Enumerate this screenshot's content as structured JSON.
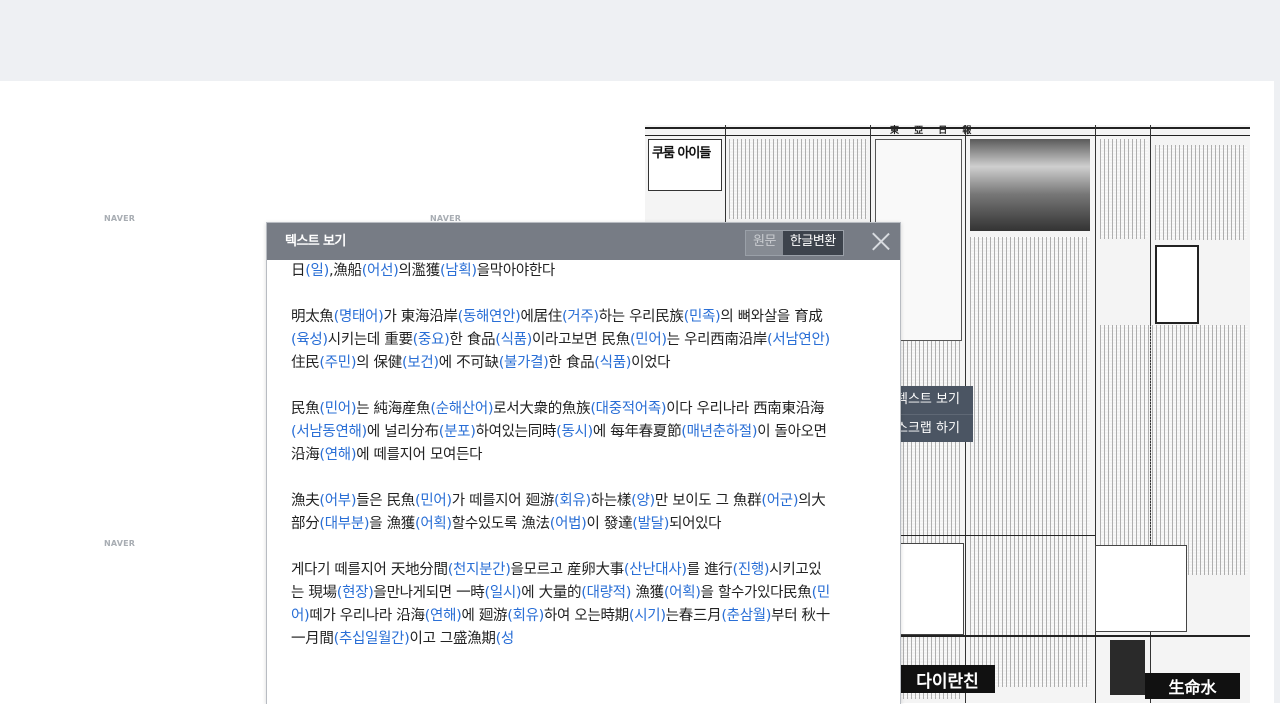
{
  "page": {
    "watermark": "NAVER"
  },
  "panel": {
    "title": "텍스트 보기",
    "toggle_original": "원문",
    "toggle_korean": "한글변환",
    "paragraphs": [
      [
        {
          "t": "日"
        },
        {
          "h": "(일)"
        },
        {
          "t": ","
        },
        {
          "t": "漁船"
        },
        {
          "h": "(어선)"
        },
        {
          "t": "의濫獲"
        },
        {
          "h": "(남획)"
        },
        {
          "t": "을막아야한다"
        }
      ],
      [
        {
          "t": " 明太魚"
        },
        {
          "h": "(명태어)"
        },
        {
          "t": "가 東海沿岸"
        },
        {
          "h": "(동해연안)"
        },
        {
          "t": "에居住"
        },
        {
          "h": "(거주)"
        },
        {
          "t": "하는 우리民族"
        },
        {
          "h": "(민족)"
        },
        {
          "t": "의 뼈와살을 育成"
        },
        {
          "h": "(육성)"
        },
        {
          "t": "시키는데 重要"
        },
        {
          "h": "(중요)"
        },
        {
          "t": "한 食品"
        },
        {
          "h": "(식품)"
        },
        {
          "t": "이라고보면 民魚"
        },
        {
          "h": "(민어)"
        },
        {
          "t": "는 우리西南沿岸"
        },
        {
          "h": "(서남연안)"
        },
        {
          "t": " 住民"
        },
        {
          "h": "(주민)"
        },
        {
          "t": "의 保健"
        },
        {
          "h": "(보건)"
        },
        {
          "t": "에 不可缺"
        },
        {
          "h": "(불가결)"
        },
        {
          "t": "한 食品"
        },
        {
          "h": "(식품)"
        },
        {
          "t": "이었다"
        }
      ],
      [
        {
          "t": " 民魚"
        },
        {
          "h": "(민어)"
        },
        {
          "t": "는 純海産魚"
        },
        {
          "h": "(순해산어)"
        },
        {
          "t": "로서大衆的魚族"
        },
        {
          "h": "(대중적어족)"
        },
        {
          "t": "이다 우리나라 西南東沿海"
        },
        {
          "h": "(서남동연해)"
        },
        {
          "t": "에 널리分布"
        },
        {
          "h": "(분포)"
        },
        {
          "t": "하여있는同時"
        },
        {
          "h": "(동시)"
        },
        {
          "t": "에 每年春夏節"
        },
        {
          "h": "(매년춘하절)"
        },
        {
          "t": "이 돌아오면 沿海"
        },
        {
          "h": "(연해)"
        },
        {
          "t": "에 떼를지어 모여든다"
        }
      ],
      [
        {
          "t": " 漁夫"
        },
        {
          "h": "(어부)"
        },
        {
          "t": "들은 民魚"
        },
        {
          "h": "(민어)"
        },
        {
          "t": "가 떼를지어 廻游"
        },
        {
          "h": "(회유)"
        },
        {
          "t": "하는樣"
        },
        {
          "h": "(양)"
        },
        {
          "t": "만 보이도 그 魚群"
        },
        {
          "h": "(어군)"
        },
        {
          "t": "의大部分"
        },
        {
          "h": "(대부분)"
        },
        {
          "t": "을 漁獲"
        },
        {
          "h": "(어획)"
        },
        {
          "t": "할수있도록 漁法"
        },
        {
          "h": "(어법)"
        },
        {
          "t": "이 發達"
        },
        {
          "h": "(발달)"
        },
        {
          "t": "되어있다"
        }
      ],
      [
        {
          "t": " 게다기 떼를지어 天地分間"
        },
        {
          "h": "(천지분간)"
        },
        {
          "t": "을모르고 産卵大事"
        },
        {
          "h": "(산난대사)"
        },
        {
          "t": "를 進行"
        },
        {
          "h": "(진행)"
        },
        {
          "t": "시키고있는 現場"
        },
        {
          "h": "(현장)"
        },
        {
          "t": "을만나게되면 一時"
        },
        {
          "h": "(일시)"
        },
        {
          "t": "에 大量的"
        },
        {
          "h": "(대량적)"
        },
        {
          "t": " 漁獲"
        },
        {
          "h": "(어획)"
        },
        {
          "t": "을 할수가있다民魚"
        },
        {
          "h": "(민어)"
        },
        {
          "t": "떼가 우리나라 沿海"
        },
        {
          "h": "(연해)"
        },
        {
          "t": "에 廻游"
        },
        {
          "h": "(회유)"
        },
        {
          "t": "하여 오는時期"
        },
        {
          "h": "(시기)"
        },
        {
          "t": "는春三月"
        },
        {
          "h": "(춘삼월)"
        },
        {
          "t": "부터 秋十一月間"
        },
        {
          "h": "(추십일월간)"
        },
        {
          "t": "이고 그盛漁期"
        },
        {
          "h": "(성"
        }
      ]
    ]
  },
  "context_menu": {
    "items": [
      "텍스트 보기",
      "스크랩 하기"
    ]
  },
  "newspaper": {
    "masthead": "東 亞 日 報",
    "ad_bottom_left": "다이란친",
    "ad_bottom_right": "生命水",
    "ad_top_left": "쿠룸 아이들"
  }
}
